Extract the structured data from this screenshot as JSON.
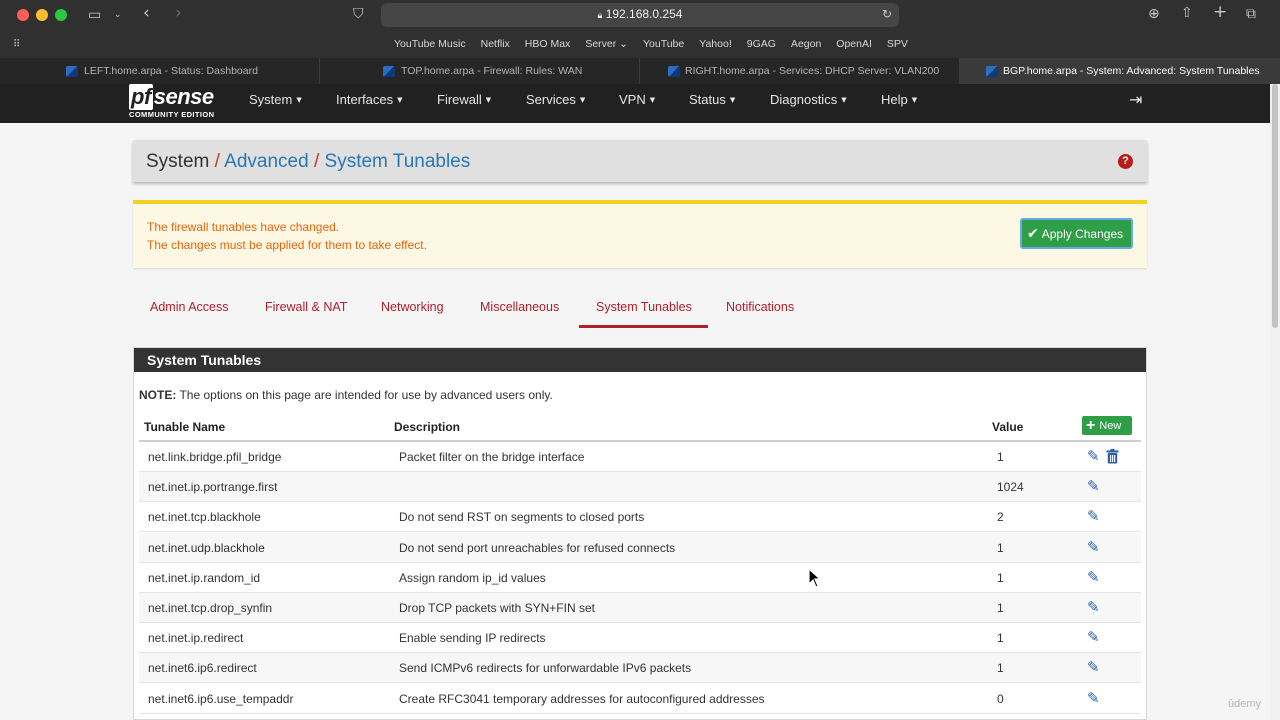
{
  "browser": {
    "url": "192.168.0.254",
    "bookmarks": [
      "YouTube Music",
      "Netflix",
      "HBO Max",
      "Server ⌄",
      "YouTube",
      "Yahoo!",
      "9GAG",
      "Aegon",
      "OpenAI",
      "SPV"
    ],
    "tabs": [
      {
        "title": "LEFT.home.arpa - Status: Dashboard",
        "active": false
      },
      {
        "title": "TOP.home.arpa - Firewall: Rules: WAN",
        "active": false
      },
      {
        "title": "RIGHT.home.arpa - Services: DHCP Server: VLAN200",
        "active": false
      },
      {
        "title": "BGP.home.arpa - System: Advanced: System Tunables",
        "active": true
      }
    ]
  },
  "brand": {
    "pf": "pf",
    "name": "sense",
    "edition": "COMMUNITY EDITION"
  },
  "nav": [
    "System",
    "Interfaces",
    "Firewall",
    "Services",
    "VPN",
    "Status",
    "Diagnostics",
    "Help"
  ],
  "breadcrumb": {
    "root": "System",
    "sep": "/",
    "level2": "Advanced",
    "level3": "System Tunables"
  },
  "alert": {
    "line1": "The firewall tunables have changed.",
    "line2": "The changes must be applied for them to take effect.",
    "apply_label": "Apply Changes"
  },
  "subtabs": [
    "Admin Access",
    "Firewall & NAT",
    "Networking",
    "Miscellaneous",
    "System Tunables",
    "Notifications"
  ],
  "active_subtab": "System Tunables",
  "panel": {
    "title": "System Tunables",
    "note_label": "NOTE:",
    "note_text": " The options on this page are intended for use by advanced users only.",
    "columns": [
      "Tunable Name",
      "Description",
      "Value"
    ],
    "new_label": "New"
  },
  "rows": [
    {
      "name": "net.link.bridge.pfil_bridge",
      "description": "Packet filter on the bridge interface",
      "value": "1",
      "deletable": true
    },
    {
      "name": "net.inet.ip.portrange.first",
      "description": "",
      "value": "1024",
      "deletable": false
    },
    {
      "name": "net.inet.tcp.blackhole",
      "description": "Do not send RST on segments to closed ports",
      "value": "2",
      "deletable": false
    },
    {
      "name": "net.inet.udp.blackhole",
      "description": "Do not send port unreachables for refused connects",
      "value": "1",
      "deletable": false
    },
    {
      "name": "net.inet.ip.random_id",
      "description": "Assign random ip_id values",
      "value": "1",
      "deletable": false
    },
    {
      "name": "net.inet.tcp.drop_synfin",
      "description": "Drop TCP packets with SYN+FIN set",
      "value": "1",
      "deletable": false
    },
    {
      "name": "net.inet.ip.redirect",
      "description": "Enable sending IP redirects",
      "value": "1",
      "deletable": false
    },
    {
      "name": "net.inet6.ip6.redirect",
      "description": "Send ICMPv6 redirects for unforwardable IPv6 packets",
      "value": "1",
      "deletable": false
    },
    {
      "name": "net.inet6.ip6.use_tempaddr",
      "description": "Create RFC3041 temporary addresses for autoconfigured addresses",
      "value": "0",
      "deletable": false
    }
  ],
  "watermark": "ûdemy",
  "colors": {
    "accent": "#b0202d",
    "link": "#2a77b5",
    "success": "#2e9e47",
    "alert_text": "#e8650c",
    "navbar": "#212121"
  }
}
